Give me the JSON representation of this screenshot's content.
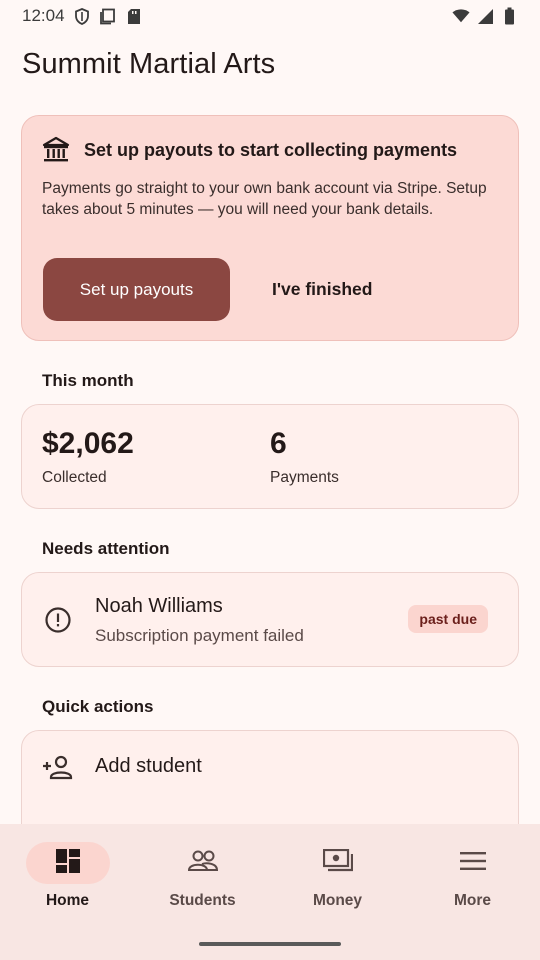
{
  "status": {
    "time": "12:04",
    "left_icons": [
      "shield-icon",
      "screen-icon",
      "sd-card-icon"
    ],
    "right_icons": [
      "wifi-icon",
      "signal-icon",
      "battery-icon"
    ]
  },
  "header": {
    "title": "Summit Martial Arts"
  },
  "payout_banner": {
    "icon": "bank-icon",
    "title": "Set up payouts to start collecting payments",
    "body": "Payments go straight to your own bank account via Stripe. Setup takes about 5 minutes — you will need your bank details.",
    "primary_button": "Set up payouts",
    "secondary_button": "I've finished"
  },
  "this_month": {
    "section_label": "This month",
    "collected_value": "$2,062",
    "collected_label": "Collected",
    "payments_value": "6",
    "payments_label": "Payments"
  },
  "needs_attention": {
    "section_label": "Needs attention",
    "items": [
      {
        "icon": "alert-circle-icon",
        "name": "Noah Williams",
        "description": "Subscription payment failed",
        "badge": "past due"
      }
    ]
  },
  "quick_actions": {
    "section_label": "Quick actions",
    "items": [
      {
        "icon": "add-person-icon",
        "label": "Add student"
      }
    ]
  },
  "bottom_nav": {
    "items": [
      {
        "label": "Home",
        "icon": "dashboard-icon",
        "active": true
      },
      {
        "label": "Students",
        "icon": "people-icon",
        "active": false
      },
      {
        "label": "Money",
        "icon": "money-icon",
        "active": false
      },
      {
        "label": "More",
        "icon": "menu-icon",
        "active": false
      }
    ]
  },
  "colors": {
    "background": "#fff8f6",
    "banner_bg": "#fcdad5",
    "primary_button": "#8b4741",
    "card_bg": "#fff0ed",
    "badge_bg": "#fbd5cf",
    "nav_bg": "#f8e6e3"
  }
}
